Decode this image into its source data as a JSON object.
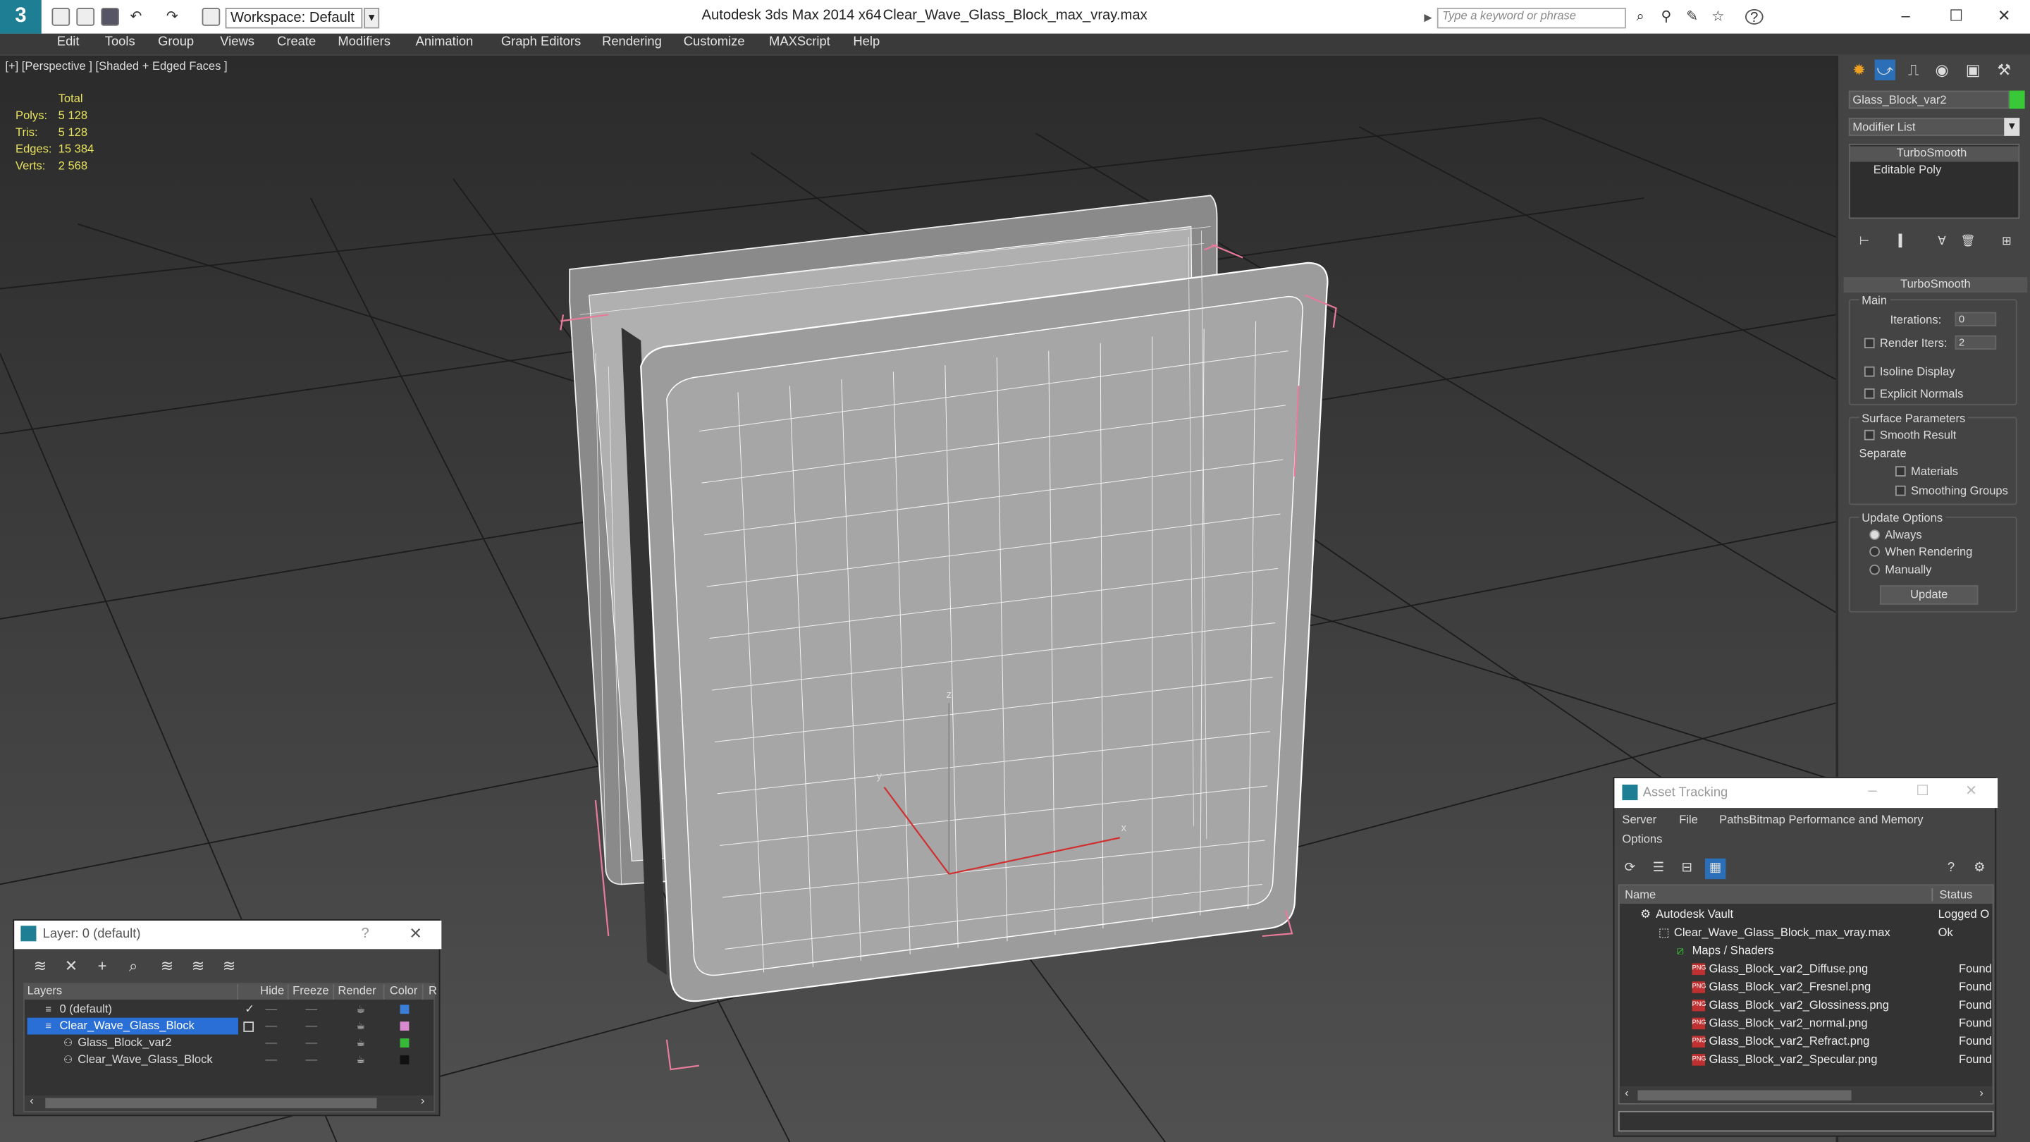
{
  "title_bar": {
    "workspace_label": "Workspace: Default",
    "app_title": "Autodesk 3ds Max  2014 x64",
    "file_name": "Clear_Wave_Glass_Block_max_vray.max",
    "search_placeholder": "Type a keyword or phrase",
    "minimize": "–",
    "maximize": "☐",
    "close": "✕"
  },
  "menu": [
    "Edit",
    "Tools",
    "Group",
    "Views",
    "Create",
    "Modifiers",
    "Animation",
    "Graph Editors",
    "Rendering",
    "Customize",
    "MAXScript",
    "Help"
  ],
  "viewport": {
    "label": "[+] [Perspective ] [Shaded + Edged Faces ]",
    "stats_header": "Total",
    "stats": [
      {
        "label": "Polys:",
        "value": "5 128"
      },
      {
        "label": "Tris:",
        "value": "5 128"
      },
      {
        "label": "Edges:",
        "value": "15 384"
      },
      {
        "label": "Verts:",
        "value": "2 568"
      }
    ],
    "axis_x": "x",
    "axis_y": "y",
    "axis_z": "z"
  },
  "command_panel": {
    "object_name": "Glass_Block_var2",
    "modifier_list": "Modifier List",
    "stack": [
      "TurboSmooth",
      "Editable Poly"
    ],
    "rollout_title": "TurboSmooth",
    "main_label": "Main",
    "iterations_label": "Iterations:",
    "iterations_value": "0",
    "render_iters_label": "Render Iters:",
    "render_iters_value": "2",
    "isoline_display": "Isoline Display",
    "explicit_normals": "Explicit Normals",
    "surface_parameters": "Surface Parameters",
    "smooth_result": "Smooth Result",
    "separate": "Separate",
    "materials": "Materials",
    "smoothing_groups": "Smoothing Groups",
    "update_options": "Update Options",
    "always": "Always",
    "when_rendering": "When Rendering",
    "manually": "Manually",
    "update_button": "Update"
  },
  "layer_window": {
    "title": "Layer: 0 (default)",
    "help": "?",
    "close": "✕",
    "columns": [
      "Layers",
      "Hide",
      "Freeze",
      "Render",
      "Color",
      "R"
    ],
    "rows": [
      {
        "name": "0 (default)",
        "color": "#3a7ed8"
      },
      {
        "name": "Clear_Wave_Glass_Block",
        "color": "#d88ad0"
      },
      {
        "name": "Glass_Block_var2",
        "color": "#38b838"
      },
      {
        "name": "Clear_Wave_Glass_Block",
        "color": "#111111"
      }
    ]
  },
  "asset_window": {
    "title": "Asset Tracking",
    "menu": [
      "Server",
      "File",
      "Paths",
      "Bitmap Performance and Memory",
      "Options"
    ],
    "columns": [
      "Name",
      "Status"
    ],
    "rows": [
      {
        "name": "Autodesk Vault",
        "status": "Logged O",
        "indent": 0
      },
      {
        "name": "Clear_Wave_Glass_Block_max_vray.max",
        "status": "Ok",
        "indent": 1
      },
      {
        "name": "Maps / Shaders",
        "status": "",
        "indent": 2
      },
      {
        "name": "Glass_Block_var2_Diffuse.png",
        "status": "Found",
        "indent": 3
      },
      {
        "name": "Glass_Block_var2_Fresnel.png",
        "status": "Found",
        "indent": 3
      },
      {
        "name": "Glass_Block_var2_Glossiness.png",
        "status": "Found",
        "indent": 3
      },
      {
        "name": "Glass_Block_var2_normal.png",
        "status": "Found",
        "indent": 3
      },
      {
        "name": "Glass_Block_var2_Refract.png",
        "status": "Found",
        "indent": 3
      },
      {
        "name": "Glass_Block_var2_Specular.png",
        "status": "Found",
        "indent": 3
      }
    ],
    "png_badge": "PNG"
  }
}
